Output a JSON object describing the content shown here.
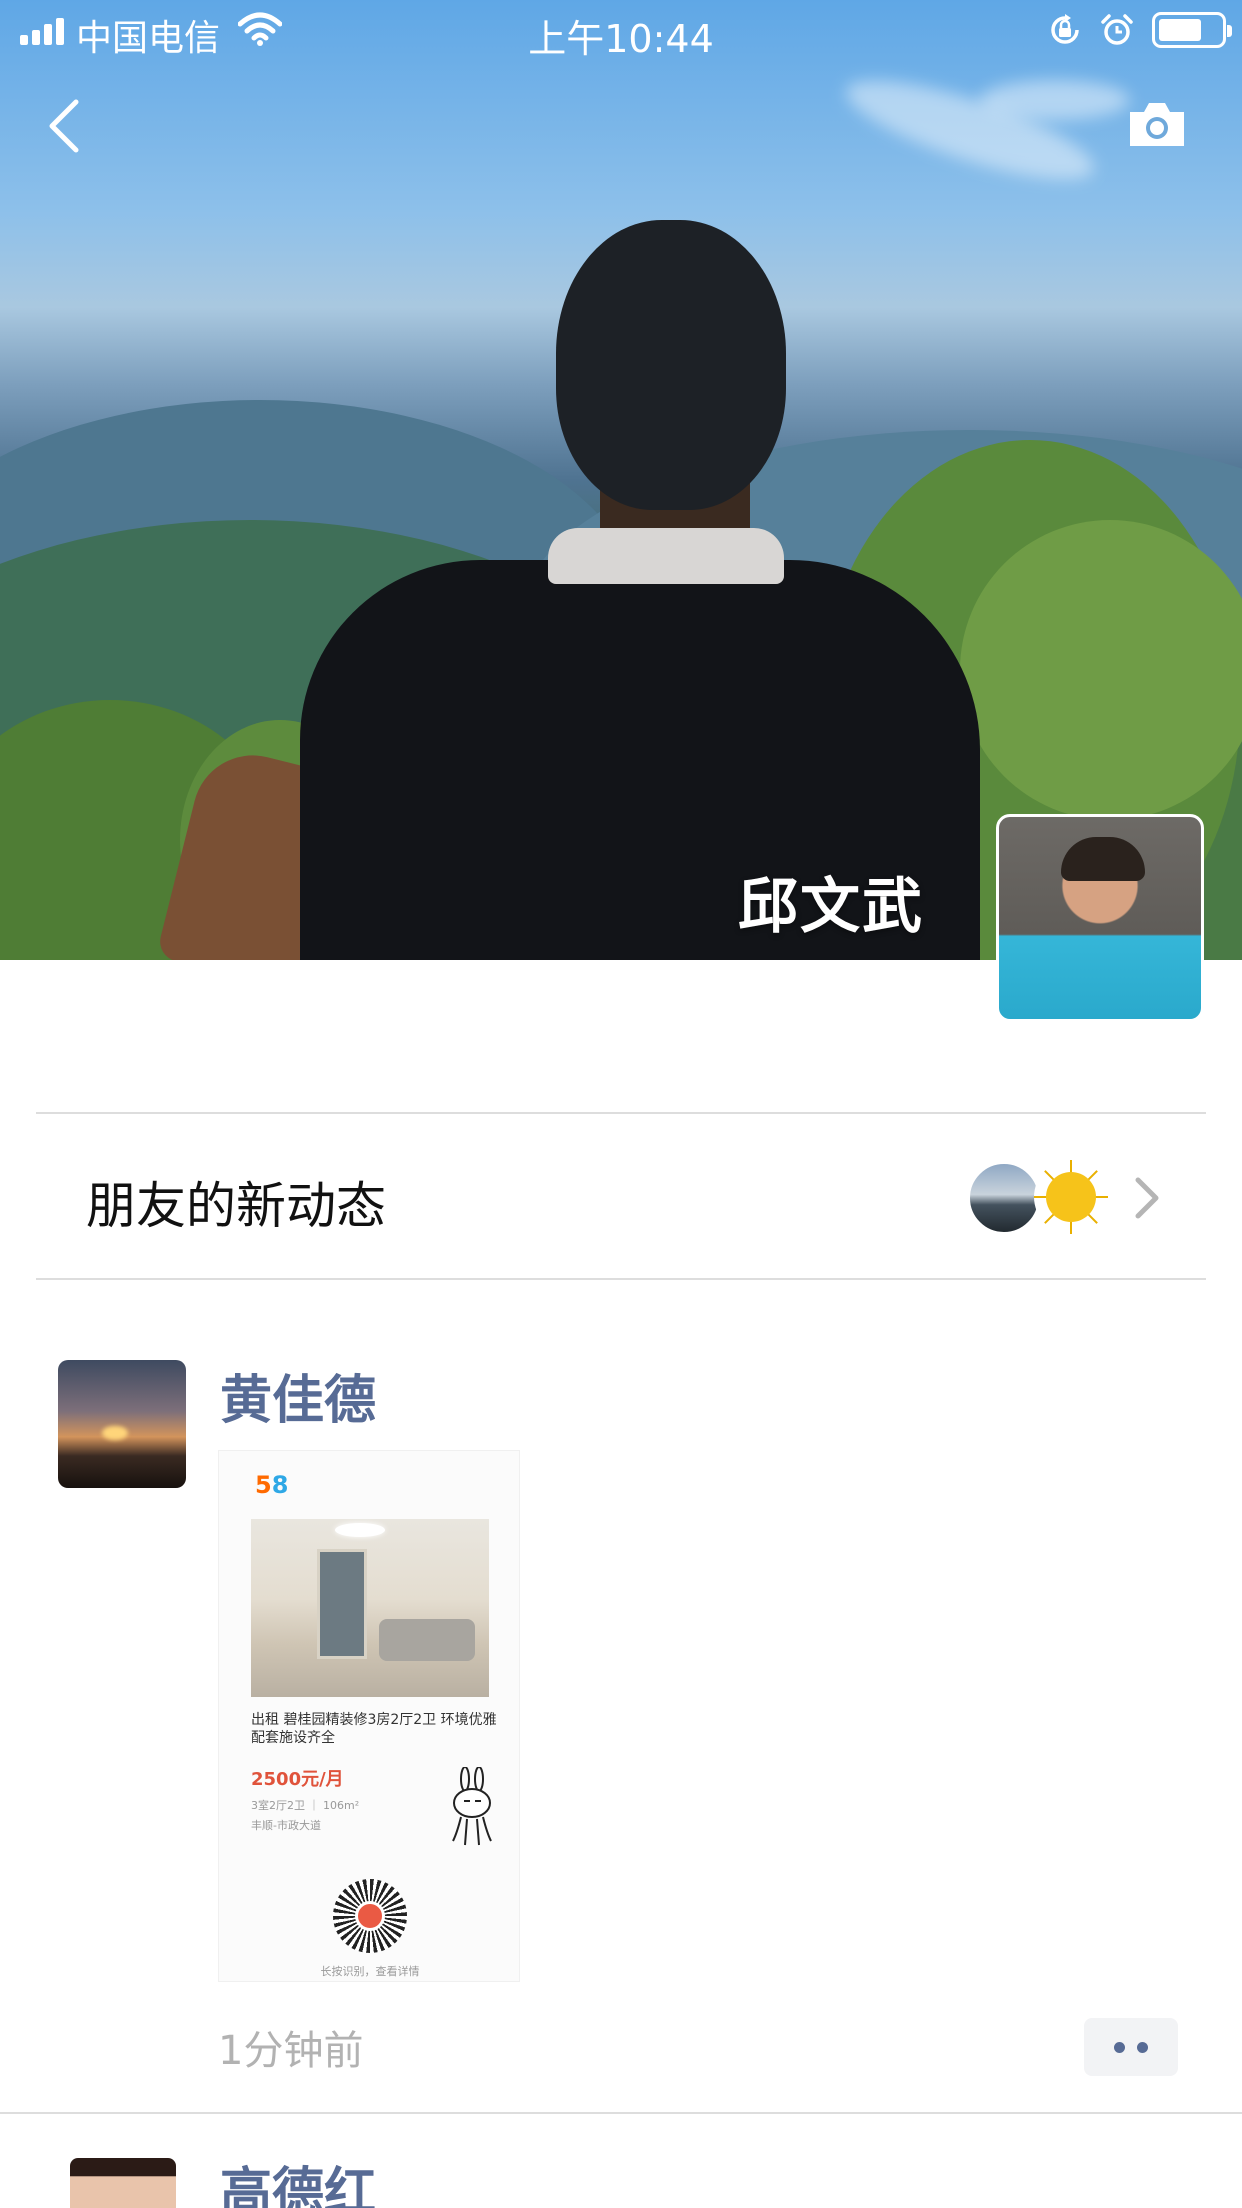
{
  "status_bar": {
    "carrier": "中国电信",
    "time": "上午10:44"
  },
  "profile": {
    "name": "邱文武"
  },
  "friends_updates": {
    "label": "朋友的新动态"
  },
  "posts": [
    {
      "author": "黄佳德",
      "time": "1分钟前",
      "attachment": {
        "logo": "58",
        "title": "出租 碧桂园精装修3房2厅2卫 环境优雅配套施设齐全",
        "price": "2500元/月",
        "spec": "3室2厅2卫 ｜ 106m²",
        "location": "丰顺-市政大道",
        "hint": "长按识别，查看详情"
      }
    },
    {
      "author": "高德红"
    }
  ],
  "colors": {
    "link_blue": "#576b95",
    "meta_gray": "#b2b2b2",
    "price_red": "#e0533b"
  },
  "icons": [
    "signal-icon",
    "wifi-icon",
    "rotation-lock-icon",
    "alarm-icon",
    "battery-icon",
    "back-arrow-icon",
    "camera-icon",
    "chevron-right-icon",
    "more-dots-icon"
  ]
}
